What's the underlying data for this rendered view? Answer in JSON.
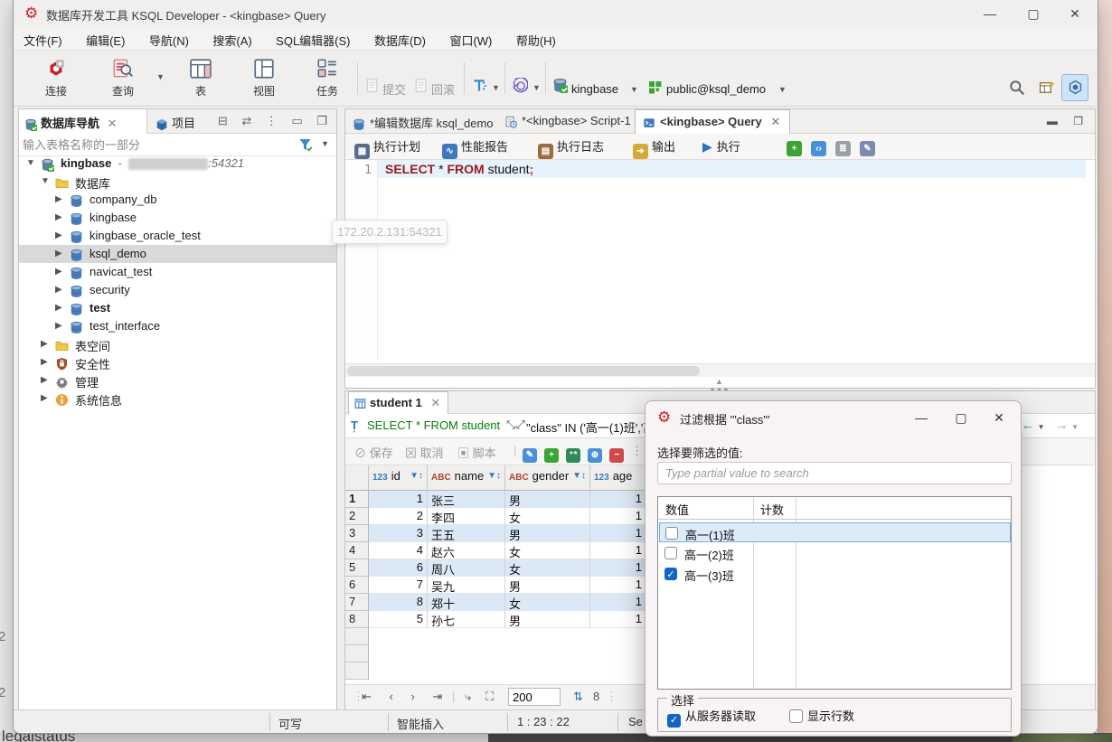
{
  "window": {
    "title": "数据库开发工具 KSQL Developer - <kingbase> Query",
    "menus": [
      "文件(F)",
      "编辑(E)",
      "导航(N)",
      "搜索(A)",
      "SQL编辑器(S)",
      "数据库(D)",
      "窗口(W)",
      "帮助(H)"
    ],
    "controls": {
      "minimize": "—",
      "maximize": "▢",
      "close": "✕"
    }
  },
  "toolbar": {
    "connect": "连接",
    "query": "查询",
    "table": "表",
    "view": "视图",
    "task": "任务",
    "commit": "提交",
    "rollback": "回滚",
    "connection": "kingbase",
    "schema": "public@ksql_demo"
  },
  "navigator": {
    "tab_db": "数据库导航",
    "tab_project": "项目",
    "filter_placeholder": "输入表格名称的一部分",
    "root_name": "kingbase",
    "root_sep": "-",
    "root_port": ":54321",
    "tooltip": "172.20.2.131:54321",
    "folder_db": "数据库",
    "databases": [
      "company_db",
      "kingbase",
      "kingbase_oracle_test",
      "ksql_demo",
      "navicat_test",
      "security",
      "test",
      "test_interface"
    ],
    "selected_database": "ksql_demo",
    "folders": [
      "表空间",
      "安全性",
      "管理",
      "系统信息"
    ]
  },
  "editor": {
    "tabs": [
      "*编辑数据库 ksql_demo",
      "*<kingbase> Script-1",
      "<kingbase> Query"
    ],
    "btn_plan": "执行计划",
    "btn_report": "性能报告",
    "btn_log": "执行日志",
    "btn_output": "输出",
    "btn_exec": "执行",
    "line_no": "1",
    "sql": {
      "select": "SELECT",
      "star": " * ",
      "from": "FROM",
      "table": " student",
      "semi": ";"
    }
  },
  "results": {
    "tab": "student 1",
    "filter_sql": "SELECT * FROM student",
    "filter_cond": "\"class\" IN ('高一(1)班','高",
    "btn_save": "保存",
    "btn_cancel": "取消",
    "btn_script": "脚本",
    "col_types": {
      "id": "123",
      "name": "ABC",
      "gender": "ABC",
      "age": "123"
    },
    "columns": {
      "id": "id",
      "name": "name",
      "gender": "gender",
      "age": "age"
    },
    "rows": [
      {
        "num": "1",
        "id": "1",
        "name": "张三",
        "gender": "男",
        "age": "1"
      },
      {
        "num": "2",
        "id": "2",
        "name": "李四",
        "gender": "女",
        "age": "1"
      },
      {
        "num": "3",
        "id": "3",
        "name": "王五",
        "gender": "男",
        "age": "1"
      },
      {
        "num": "4",
        "id": "4",
        "name": "赵六",
        "gender": "女",
        "age": "1"
      },
      {
        "num": "5",
        "id": "6",
        "name": "周八",
        "gender": "女",
        "age": "1"
      },
      {
        "num": "6",
        "id": "7",
        "name": "吴九",
        "gender": "男",
        "age": "1"
      },
      {
        "num": "7",
        "id": "8",
        "name": "郑十",
        "gender": "女",
        "age": "1"
      },
      {
        "num": "8",
        "id": "5",
        "name": "孙七",
        "gender": "男",
        "age": "1"
      }
    ],
    "fetch_size": "200",
    "row_count": "8"
  },
  "statusbar": {
    "writable": "可写",
    "insert": "智能插入",
    "caret": "1 : 23 : 22",
    "partial": "Se"
  },
  "dialog": {
    "title": "过滤根据 '\"class\"'",
    "label": "选择要筛选的值:",
    "search_placeholder": "Type partial value to search",
    "col_value": "数值",
    "col_count": "计数",
    "items": [
      {
        "label": "高一(1)班",
        "checked": false
      },
      {
        "label": "高一(2)班",
        "checked": false
      },
      {
        "label": "高一(3)班",
        "checked": true
      }
    ],
    "group": "选择",
    "opt_server": "从服务器读取",
    "opt_rowcount": "显示行数"
  },
  "background": {
    "artifact_text": "legalstatus",
    "artifact_2a": "2",
    "artifact_2b": "2"
  },
  "colors": {
    "accent": "#2675bf",
    "logo_red": "#c3272b",
    "sql_keyword": "#9a1b1b",
    "filter_green": "#0a7d0a",
    "checked_blue": "#1366c2",
    "row_alt_blue": "#dbe8f6"
  }
}
